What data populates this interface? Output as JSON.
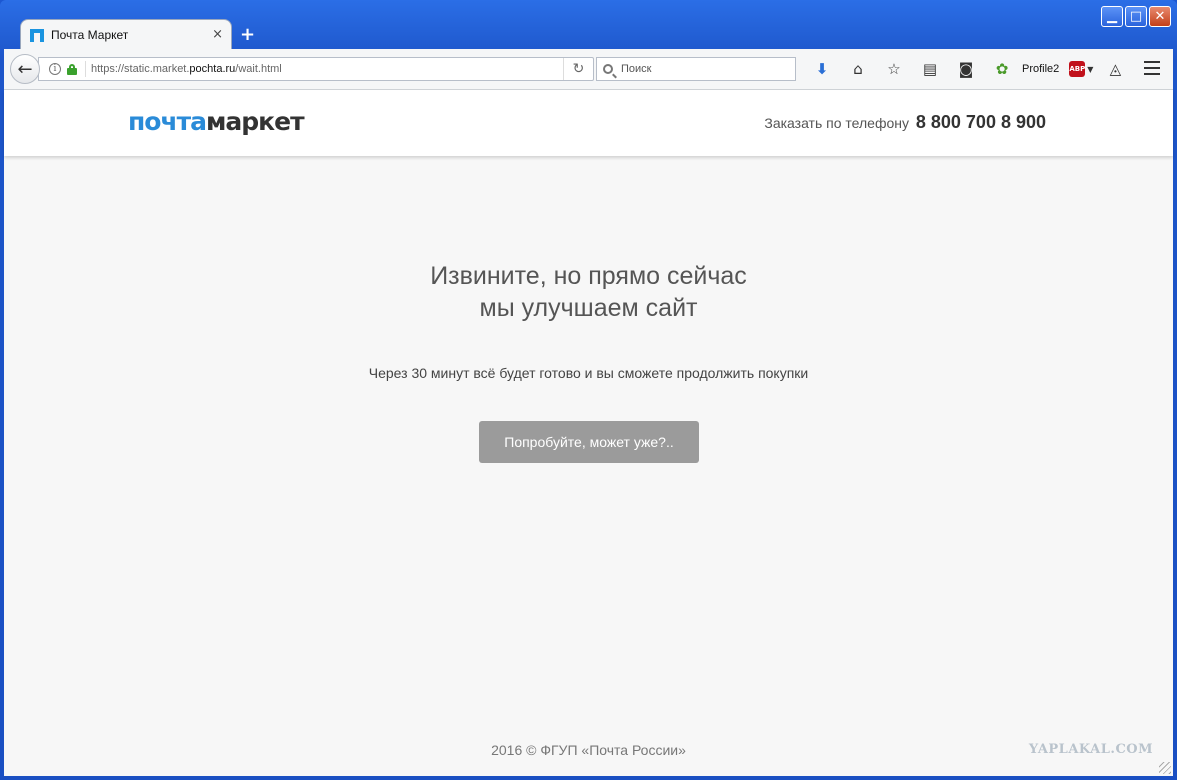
{
  "browser": {
    "tab_title": "Почта Маркет",
    "tab_close": "×",
    "new_tab": "+",
    "url_prefix": "https://static.market.",
    "url_domain": "pochta.ru",
    "url_path": "/wait.html",
    "search_placeholder": "Поиск",
    "profile_label": "Profile2",
    "abp_label": "ABP",
    "window_controls": {
      "minimize": "▁",
      "maximize": "□",
      "close": "✕"
    }
  },
  "site": {
    "logo_part1": "почта",
    "logo_part2": "маркет",
    "phone_label": "Заказать по телефону",
    "phone_number": "8 800 700 8 900",
    "title_line1": "Извините, но прямо сейчас",
    "title_line2": "мы улучшаем сайт",
    "subtitle": "Через 30 минут всё будет готово и вы сможете продолжить покупки",
    "retry_button": "Попробуйте, может уже?..",
    "footer": "2016 © ФГУП «Почта России»",
    "watermark": "YAPLAKAL.COM"
  },
  "colors": {
    "brand_blue": "#2a8bd8",
    "button_gray": "#9b9b9b",
    "page_bg": "#f7f7f7"
  }
}
